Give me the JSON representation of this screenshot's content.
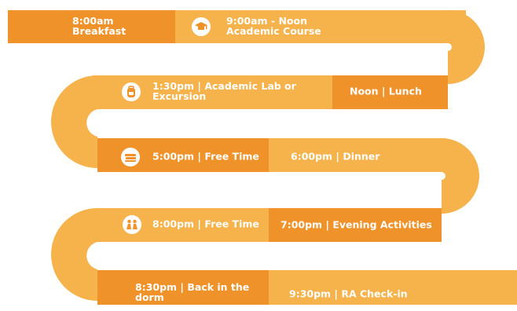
{
  "colors": {
    "dark_orange": "#f0922a",
    "light_orange": "#f6b24b",
    "text": "#ffffff",
    "icon_fill": "#ffffff",
    "icon_detail": "#f0922a"
  },
  "schedule": [
    {
      "id": "breakfast",
      "line1": "8:00am",
      "line2": "Breakfast",
      "icon": null
    },
    {
      "id": "academic-course",
      "line1": "9:00am - Noon",
      "line2": "Academic Course",
      "icon": "graduation-cap-icon"
    },
    {
      "id": "lunch",
      "line1": "Noon | Lunch",
      "line2": "",
      "icon": null
    },
    {
      "id": "academic-lab",
      "line1": "1:30pm | Academic Lab or",
      "line2": "Excursion",
      "icon": "backpack-icon"
    },
    {
      "id": "free-time-1",
      "line1": "5:00pm | Free Time",
      "line2": "",
      "icon": "books-icon"
    },
    {
      "id": "dinner",
      "line1": "6:00pm | Dinner",
      "line2": "",
      "icon": null
    },
    {
      "id": "evening-activities",
      "line1": "7:00pm | Evening Activities",
      "line2": "",
      "icon": null
    },
    {
      "id": "free-time-2",
      "line1": "8:00pm | Free Time",
      "line2": "",
      "icon": "people-icon"
    },
    {
      "id": "back-in-dorm",
      "line1": "8:30pm | Back in the",
      "line2": "dorm",
      "icon": null
    },
    {
      "id": "ra-check-in",
      "line1": "9:30pm | RA Check-in",
      "line2": "",
      "icon": null
    }
  ]
}
